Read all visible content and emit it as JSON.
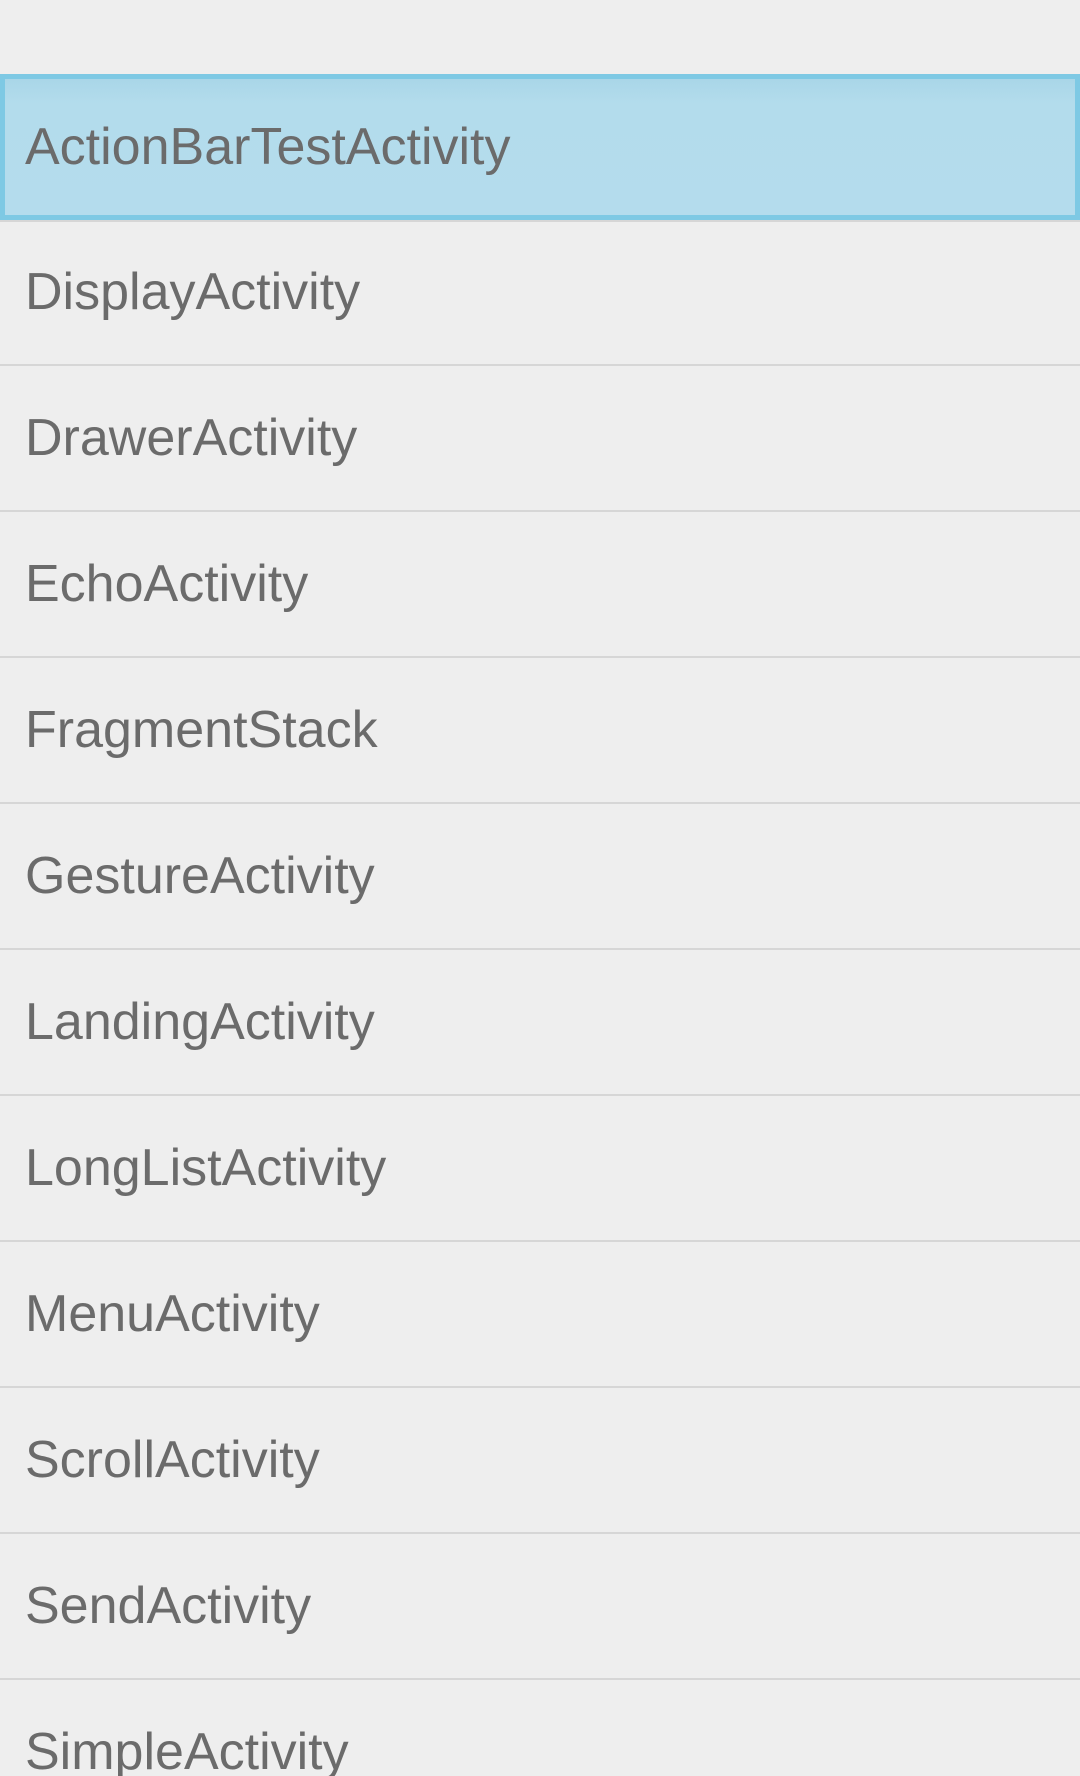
{
  "list": {
    "items": [
      {
        "label": "ActionBarTestActivity",
        "selected": true
      },
      {
        "label": "DisplayActivity"
      },
      {
        "label": "DrawerActivity"
      },
      {
        "label": "EchoActivity"
      },
      {
        "label": "FragmentStack"
      },
      {
        "label": "GestureActivity"
      },
      {
        "label": "LandingActivity"
      },
      {
        "label": "LongListActivity"
      },
      {
        "label": "MenuActivity"
      },
      {
        "label": "ScrollActivity"
      },
      {
        "label": "SendActivity"
      },
      {
        "label": "SimpleActivity"
      }
    ]
  },
  "colors": {
    "background": "#eeeeee",
    "text": "#6b6b6b",
    "divider": "#d6d6d6",
    "selected_fill": "#b4dced",
    "selected_border": "#7ec9e4"
  }
}
